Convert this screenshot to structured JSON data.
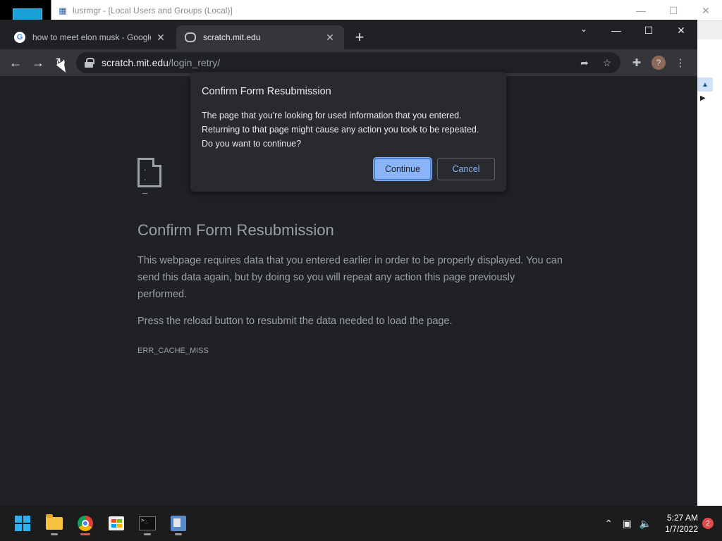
{
  "background_window": {
    "title": "lusrmgr - [Local Users and Groups (Local)]",
    "controls": [
      "—",
      "☐",
      "✕"
    ]
  },
  "browser": {
    "tabs": [
      {
        "label": "how to meet elon musk - Google",
        "favicon": "google-icon",
        "active": false
      },
      {
        "label": "scratch.mit.edu",
        "favicon": "scratch-icon",
        "active": true
      }
    ],
    "new_tab_label": "+",
    "address_bar": {
      "host": "scratch.mit.edu",
      "path": "/login_retry/"
    },
    "profile_initial": "?"
  },
  "error_page": {
    "title": "Confirm Form Resubmission",
    "paragraph1": "This webpage requires data that you entered earlier in order to be properly displayed. You can send this data again, but by doing so you will repeat any action this page previously performed.",
    "paragraph2": "Press the reload button to resubmit the data needed to load the page.",
    "error_code": "ERR_CACHE_MISS"
  },
  "dialog": {
    "title": "Confirm Form Resubmission",
    "message_line1": "The page that you're looking for used information that you entered.",
    "message_line2": "Returning to that page might cause any action you took to be repeated.",
    "message_line3": "Do you want to continue?",
    "continue_label": "Continue",
    "cancel_label": "Cancel"
  },
  "taskbar": {
    "apps": [
      "start-icon",
      "file-explorer-icon",
      "chrome-icon",
      "store-icon",
      "terminal-icon",
      "computer-management-icon"
    ],
    "clock_time": "5:27 AM",
    "clock_date": "1/7/2022",
    "notification_count": "2"
  },
  "colors": {
    "chrome_bg": "#202124",
    "toolbar_bg": "#35363a",
    "accent_blue": "#8ab4f8",
    "text_muted": "#9aa0a6"
  }
}
